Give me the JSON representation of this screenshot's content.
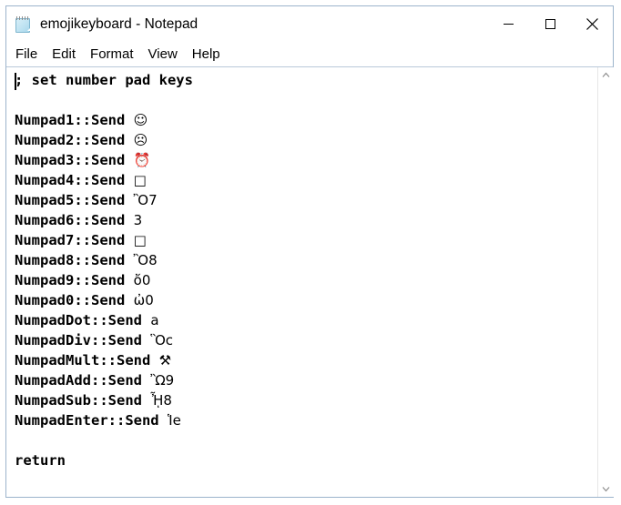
{
  "window": {
    "title": "emojikeyboard - Notepad",
    "app_icon": "notepad-icon",
    "controls": {
      "minimize": "minimize-icon",
      "maximize": "maximize-icon",
      "close": "close-icon"
    }
  },
  "menubar": {
    "items": [
      {
        "label": "File"
      },
      {
        "label": "Edit"
      },
      {
        "label": "Format"
      },
      {
        "label": "View"
      },
      {
        "label": "Help"
      }
    ]
  },
  "editor": {
    "lines": [
      {
        "text": "; set number pad keys",
        "emoji": ""
      },
      {
        "text": "",
        "emoji": ""
      },
      {
        "text": "Numpad1::Send ",
        "emoji": "☺"
      },
      {
        "text": "Numpad2::Send ",
        "emoji": "☹"
      },
      {
        "text": "Numpad3::Send ",
        "emoji": "⏰"
      },
      {
        "text": "Numpad4::Send ",
        "emoji": "□"
      },
      {
        "text": "Numpad5::Send ",
        "emoji": "Ὂ7"
      },
      {
        "text": "Numpad6::Send ",
        "emoji": "὆3"
      },
      {
        "text": "Numpad7::Send ",
        "emoji": "□"
      },
      {
        "text": "Numpad8::Send ",
        "emoji": "Ὂ8"
      },
      {
        "text": "Numpad9::Send ",
        "emoji": "ὄ0"
      },
      {
        "text": "Numpad0::Send ",
        "emoji": "ὠ0"
      },
      {
        "text": "NumpadDot::Send ",
        "emoji": "὘a"
      },
      {
        "text": "NumpadDiv::Send ",
        "emoji": "Ὃc"
      },
      {
        "text": "NumpadMult::Send ",
        "emoji": "⚒"
      },
      {
        "text": "NumpadAdd::Send ",
        "emoji": "Ὢ9"
      },
      {
        "text": "NumpadSub::Send ",
        "emoji": "ᾞ8"
      },
      {
        "text": "NumpadEnter::Send ",
        "emoji": "Ἱe"
      },
      {
        "text": "",
        "emoji": ""
      },
      {
        "text": "return",
        "emoji": ""
      }
    ]
  },
  "scrollbar": {
    "up_arrow": "chevron-up-icon",
    "down_arrow": "chevron-down-icon"
  },
  "colors": {
    "window_border": "#9cb4cc",
    "text": "#000000",
    "background": "#ffffff",
    "menu_separator": "#b8c9da"
  }
}
